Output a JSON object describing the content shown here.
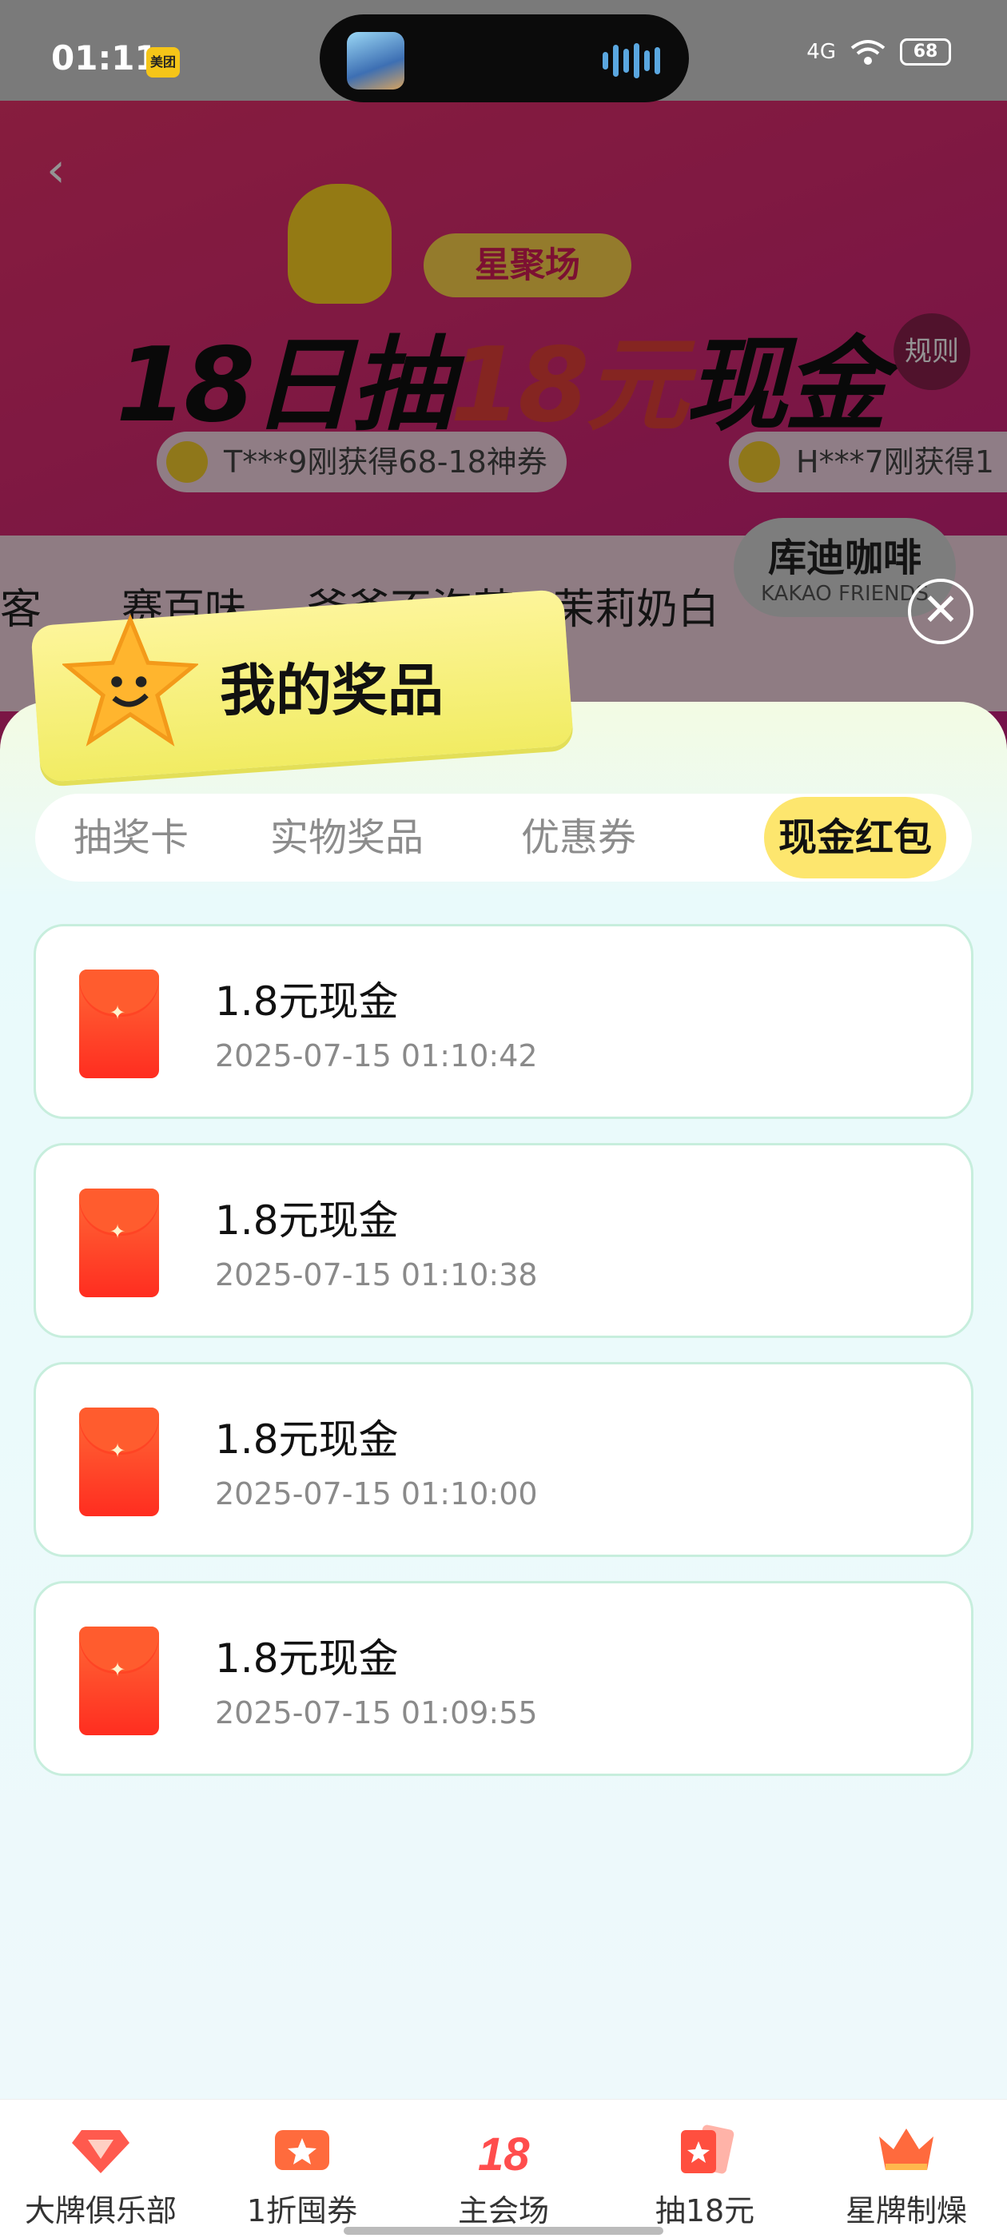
{
  "status_bar": {
    "time": "01:11",
    "app_badge": "美团",
    "network": "4G",
    "battery": "68"
  },
  "background": {
    "logo_text": "星聚场",
    "title_prefix": "18日抽",
    "title_highlight": "18元",
    "title_suffix": "现金",
    "rules": "规则",
    "tickers": [
      "T***9刚获得68-18神券",
      "H***7刚获得1"
    ],
    "brands": [
      "客",
      "赛百味",
      "爷爷不泡茶",
      "茉莉奶白"
    ],
    "kakao_title": "库迪咖啡",
    "kakao_sub": "KAKAO FRIENDS"
  },
  "panel": {
    "title": "我的奖品",
    "close": "✕",
    "tabs": [
      {
        "label": "抽奖卡",
        "active": false
      },
      {
        "label": "实物奖品",
        "active": false
      },
      {
        "label": "优惠券",
        "active": false
      },
      {
        "label": "现金红包",
        "active": true
      }
    ],
    "prizes": [
      {
        "name": "1.8元现金",
        "time": "2025-07-15 01:10:42"
      },
      {
        "name": "1.8元现金",
        "time": "2025-07-15 01:10:38"
      },
      {
        "name": "1.8元现金",
        "time": "2025-07-15 01:10:00"
      },
      {
        "name": "1.8元现金",
        "time": "2025-07-15 01:09:55"
      }
    ]
  },
  "bottom_nav": [
    {
      "label": "大牌俱乐部",
      "icon": "diamond-icon",
      "color": "#ff5a4e"
    },
    {
      "label": "1折囤券",
      "icon": "ticket-icon",
      "color": "#ff6b3d"
    },
    {
      "label": "主会场",
      "icon": "18-icon",
      "color": "#ff4d4d"
    },
    {
      "label": "抽18元",
      "icon": "cards-icon",
      "color": "#ff4f3f"
    },
    {
      "label": "星牌制燥",
      "icon": "crown-icon",
      "color": "#ff6a3d"
    }
  ],
  "colors": {
    "tab_active": "#fde66e",
    "header": "#f1ec63",
    "envelope": "#ff3b24"
  }
}
